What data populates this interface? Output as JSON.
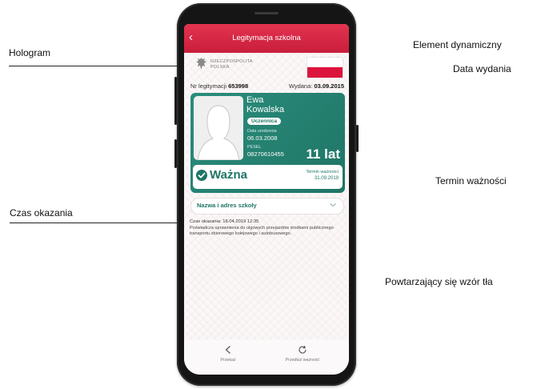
{
  "callouts": {
    "hologram": "Hologram",
    "czas_okazania": "Czas okazania",
    "element_dynamiczny": "Element dynamiczny",
    "data_wydania": "Data wydania",
    "termin_waznosci": "Termin ważności",
    "wzor_tla": "Powtarzający się wzór tła"
  },
  "app": {
    "title": "Legitymacja szkolna",
    "back_glyph": "‹"
  },
  "header": {
    "rp_line1": "RZECZPOSPOLITA",
    "rp_line2": "POLSKA"
  },
  "meta": {
    "nr_label": "Nr legitymacji",
    "nr_value": "653998",
    "issued_label": "Wydana:",
    "issued_value": "03.09.2015"
  },
  "card": {
    "first_name": "Ewa",
    "last_name": "Kowalska",
    "role_badge": "Uczennica",
    "dob_label": "Data urodzenia",
    "dob_value": "06.03.2008",
    "pesel_label": "PESEL",
    "pesel_value": "08270610455",
    "age": "11 lat",
    "status": "Ważna",
    "expiry_label": "Termin ważności",
    "expiry_value": "31.09.2019"
  },
  "school": {
    "dropdown_label": "Nazwa i adres szkoły"
  },
  "display_time": "Czas okazania: 18.04.2019 12:35",
  "notice": "Poświadcza uprawnienia do ulgowych przejazdów środkami publicznego transportu zbiorowego kolejowego i autobusowego.",
  "bottom_bar": {
    "share_label": "Przekaż",
    "renew_label": "Przedłuż ważność"
  },
  "colors": {
    "header_red": "#d42742",
    "card_green": "#1f7566",
    "flag_red": "#dc143c"
  },
  "icons": [
    "back-arrow-icon",
    "eagle-emblem-icon",
    "polish-flag-icon",
    "check-circle-icon",
    "chevron-down-icon",
    "share-icon",
    "refresh-icon"
  ]
}
